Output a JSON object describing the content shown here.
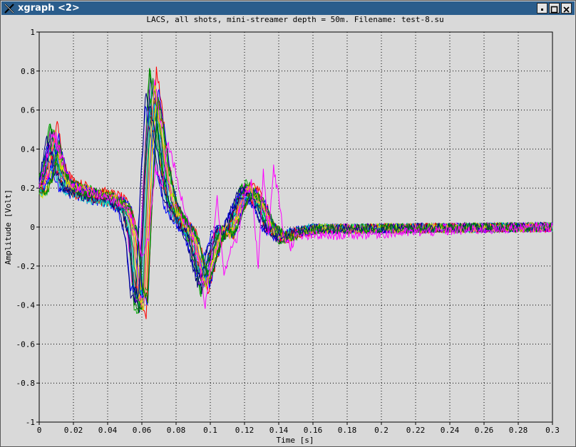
{
  "window": {
    "title": "xgraph <2>",
    "icon": "x-logo-icon",
    "buttons": [
      "minimize-icon",
      "maximize-icon",
      "close-icon"
    ]
  },
  "colors": {
    "titlebar": "#2a5d8c",
    "background": "#d9d9d9",
    "grid": "#000000"
  },
  "chart_data": {
    "type": "line",
    "title": "LACS, all shots, mini-streamer depth = 50m. Filename: test-8.su",
    "xlabel": "Time [s]",
    "ylabel": "Amplitude [Volt]",
    "xlim": [
      0,
      0.3
    ],
    "ylim": [
      -1,
      1
    ],
    "xticks": [
      "0",
      "0.02",
      "0.04",
      "0.06",
      "0.08",
      "0.1",
      "0.12",
      "0.14",
      "0.16",
      "0.18",
      "0.2",
      "0.22",
      "0.24",
      "0.26",
      "0.28",
      "0.3"
    ],
    "yticks": [
      "1",
      "0.8",
      "0.6",
      "0.4",
      "0.2",
      "0",
      "-0.2",
      "-0.4",
      "-0.6",
      "-0.8",
      "-1"
    ],
    "grid": true,
    "legend": "none",
    "series_colors": [
      "#0000ff",
      "#00aa00",
      "#ff0000",
      "#00cccc",
      "#ff00ff",
      "#e0e000",
      "#000080",
      "#008000"
    ],
    "base_trace": {
      "t": [
        0,
        0.004,
        0.008,
        0.012,
        0.016,
        0.02,
        0.03,
        0.04,
        0.045,
        0.05,
        0.054,
        0.057,
        0.06,
        0.063,
        0.066,
        0.069,
        0.073,
        0.077,
        0.081,
        0.085,
        0.089,
        0.093,
        0.096,
        0.1,
        0.103,
        0.107,
        0.11,
        0.114,
        0.118,
        0.122,
        0.126,
        0.13,
        0.134,
        0.138,
        0.142,
        0.146,
        0.15,
        0.155,
        0.16,
        0.3
      ],
      "y": [
        0.2,
        0.26,
        0.47,
        0.3,
        0.22,
        0.2,
        0.17,
        0.15,
        0.14,
        0.1,
        -0.05,
        -0.35,
        -0.4,
        0.25,
        0.72,
        0.55,
        0.3,
        0.12,
        0.05,
        0.0,
        -0.05,
        -0.2,
        -0.3,
        -0.18,
        -0.08,
        0.0,
        -0.05,
        0.05,
        0.15,
        0.2,
        0.16,
        0.1,
        0.0,
        -0.03,
        -0.06,
        -0.05,
        -0.03,
        -0.02,
        -0.01,
        0.0
      ]
    },
    "trace_count": 24,
    "shift_range": [
      -0.004,
      0.004
    ],
    "noise_amplitude": 0.025,
    "outlier_trace": {
      "color": "#ff00ff",
      "t": [
        0,
        0.008,
        0.02,
        0.04,
        0.052,
        0.056,
        0.06,
        0.064,
        0.068,
        0.072,
        0.075,
        0.078,
        0.082,
        0.088,
        0.094,
        0.097,
        0.1,
        0.104,
        0.108,
        0.112,
        0.116,
        0.12,
        0.124,
        0.128,
        0.131,
        0.134,
        0.137,
        0.14,
        0.143,
        0.147,
        0.15,
        0.3
      ],
      "y": [
        0.2,
        0.48,
        0.2,
        0.15,
        0.1,
        0.0,
        -0.15,
        -0.05,
        0.3,
        0.2,
        0.43,
        0.35,
        0.18,
        0.0,
        -0.2,
        -0.4,
        -0.2,
        0.15,
        -0.25,
        -0.1,
        -0.05,
        0.15,
        0.22,
        -0.2,
        0.3,
        -0.05,
        0.3,
        0.15,
        -0.05,
        -0.1,
        -0.05,
        0.0
      ]
    }
  }
}
